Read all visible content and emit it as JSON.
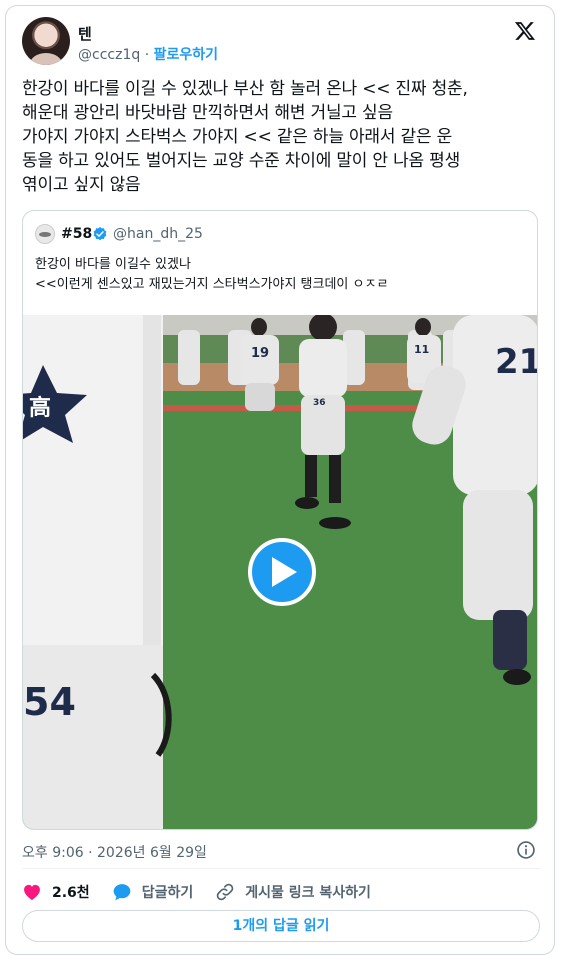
{
  "author": {
    "name": "텐",
    "handle": "@cccz1q",
    "separator": "·",
    "follow_label": "팔로우하기"
  },
  "tweet": {
    "text": "한강이 바다를 이길 수 있겠나 부산 함 놀러 온나 << 진짜 청춘,\n해운대 광안리 바닷바람 만끽하면서 해변 거닐고 싶음\n가야지 가야지 스타벅스 가야지 << 같은 하늘 아래서 같은 운\n동을 하고 있어도 벌어지는 교양 수준 차이에 말이 안 나옴 평생\n엮이고 싶지 않음"
  },
  "quote": {
    "name": "#58",
    "handle": "@han_dh_25",
    "text": "한강이 바다를 이길수 있겠나\n<<이런게 센스있고 재밌는거지 스타벅스가야지 탱크데이 ㅇㅈㄹ",
    "jersey_numbers": [
      "19",
      "36",
      "11",
      "21",
      "54"
    ],
    "emblem_text": "高"
  },
  "meta": {
    "timestamp": "오후 9:06 · 2026년 6월 29일"
  },
  "actions": {
    "likes": "2.6천",
    "reply_label": "답글하기",
    "copy_link_label": "게시물 링크 복사하기"
  },
  "read_replies_label": "1개의 답글 읽기",
  "colors": {
    "accent": "#1d9bf0",
    "like": "#f91880",
    "text": "#0f1419",
    "secondary": "#536471",
    "border": "#cfd9de"
  },
  "icons": [
    "x-logo-icon",
    "verified-badge-icon",
    "play-icon",
    "info-icon",
    "heart-icon",
    "reply-bubble-icon",
    "link-icon"
  ]
}
